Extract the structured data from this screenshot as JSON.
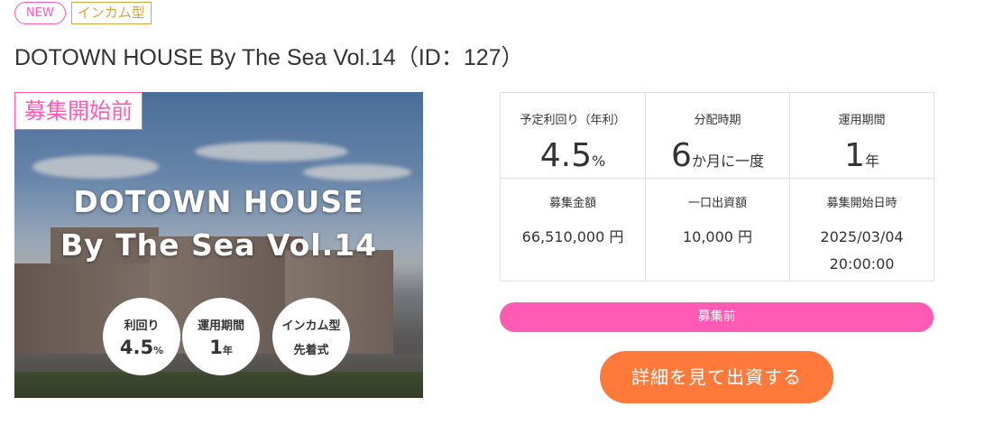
{
  "tags": {
    "new": "NEW",
    "type": "インカム型"
  },
  "title": "DOTOWN HOUSE By The Sea Vol.14（ID：127）",
  "hero": {
    "status": "募集開始前",
    "line1": "DOTOWN HOUSE",
    "line2": "By The Sea Vol.14",
    "badges": [
      {
        "label": "利回り",
        "value": "4.5",
        "unit": "%"
      },
      {
        "label": "運用期間",
        "value": "1",
        "unit": "年"
      },
      {
        "label": "インカム型",
        "value": "先着式",
        "unit": ""
      }
    ]
  },
  "stats": {
    "yield_label": "予定利回り（年利）",
    "yield_value": "4.5",
    "yield_unit": "%",
    "dist_label": "分配時期",
    "dist_value": "6",
    "dist_unit": "か月に一度",
    "term_label": "運用期間",
    "term_value": "1",
    "term_unit": "年",
    "amount_label": "募集金額",
    "amount_value": "66,510,000 円",
    "unit_label": "一口出資額",
    "unit_value": "10,000 円",
    "start_label": "募集開始日時",
    "start_date": "2025/03/04",
    "start_time": "20:00:00"
  },
  "progress_label": "募集前",
  "cta_label": "詳細を見て出資する",
  "colors": {
    "pink": "#ff5ab4",
    "orange": "#ff7a3a",
    "gold": "#d9a53b"
  }
}
